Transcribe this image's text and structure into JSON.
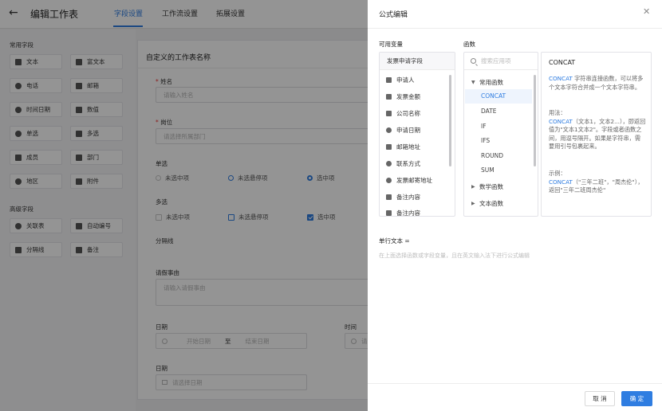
{
  "header": {
    "back_icon": "arrow-left-icon",
    "title": "编辑工作表",
    "tabs": [
      {
        "label": "字段设置",
        "active": true
      },
      {
        "label": "工作流设置",
        "active": false
      },
      {
        "label": "拓展设置",
        "active": false
      }
    ],
    "accent_color": "#2f7de1"
  },
  "sidebar": {
    "common_title": "常用字段",
    "common_items": [
      {
        "label": "文本",
        "icon": "text-icon"
      },
      {
        "label": "富文本",
        "icon": "rich-text-icon"
      },
      {
        "label": "电话",
        "icon": "phone-icon"
      },
      {
        "label": "邮箱",
        "icon": "mail-icon"
      },
      {
        "label": "时间日期",
        "icon": "clock-icon"
      },
      {
        "label": "数值",
        "icon": "number-icon"
      },
      {
        "label": "单选",
        "icon": "radio-icon"
      },
      {
        "label": "多选",
        "icon": "checkbox-icon"
      },
      {
        "label": "成员",
        "icon": "user-icon"
      },
      {
        "label": "部门",
        "icon": "department-icon"
      },
      {
        "label": "地区",
        "icon": "location-icon"
      },
      {
        "label": "附件",
        "icon": "attachment-icon"
      }
    ],
    "advanced_title": "高级字段",
    "advanced_items": [
      {
        "label": "关联表",
        "icon": "link-icon"
      },
      {
        "label": "自动编号",
        "icon": "auto-number-icon"
      },
      {
        "label": "分隔线",
        "icon": "divider-icon"
      },
      {
        "label": "备注",
        "icon": "note-icon"
      }
    ]
  },
  "form": {
    "title": "自定义的工作表名称",
    "name_label": "姓名",
    "name_placeholder": "请输入姓名",
    "position_label": "岗位",
    "position_placeholder": "请选择所属部门",
    "single_label": "单选",
    "single_options": [
      "未选中项",
      "未选悬停项",
      "选中项"
    ],
    "multi_label": "多选",
    "multi_options": [
      "未选中项",
      "未选悬停项",
      "选中项"
    ],
    "divider_label": "分隔线",
    "reason_label": "请假事由",
    "reason_placeholder": "请输入请假事由",
    "date_label": "日期",
    "date_start": "开始日期",
    "date_to": "至",
    "date_end": "结束日期",
    "time_label": "时间",
    "time_placeholder": "请",
    "date2_label": "日期",
    "date2_placeholder": "请选择日期"
  },
  "drawer": {
    "title": "公式编辑",
    "close_icon": "close-icon",
    "vars_heading": "可用变量",
    "vars_group": "发票申请字段",
    "vars": [
      {
        "label": "申请人",
        "icon": "user-icon"
      },
      {
        "label": "发票金额",
        "icon": "number-icon"
      },
      {
        "label": "公司名称",
        "icon": "text-icon"
      },
      {
        "label": "申请日期",
        "icon": "clock-icon"
      },
      {
        "label": "邮箱地址",
        "icon": "mail-icon"
      },
      {
        "label": "联系方式",
        "icon": "phone-icon"
      },
      {
        "label": "发票邮寄地址",
        "icon": "location-icon"
      },
      {
        "label": "备注内容",
        "icon": "note-icon"
      },
      {
        "label": "备注内容",
        "icon": "note-icon"
      }
    ],
    "funcs_heading": "函数",
    "search_placeholder": "搜索应用项",
    "func_groups": [
      {
        "label": "常用函数",
        "expanded": true,
        "items": [
          "CONCAT",
          "DATE",
          "IF",
          "IFS",
          "ROUND",
          "SUM"
        ],
        "selected": "CONCAT"
      },
      {
        "label": "数学函数",
        "expanded": false
      },
      {
        "label": "文本函数",
        "expanded": false
      }
    ],
    "desc": {
      "title": "CONCAT",
      "summary_fn": "CONCAT",
      "summary": " 字符串连接函数，可以将多个文本字符合并成一个文本字符串。",
      "usage_label": "用法：",
      "usage_fn": "CONCAT",
      "usage": "（文本1，文本2...），即返回值为\"文本1文本2\"。字段或者函数之间，用逗号隔开。如果是字符串，需要用引号包裹起来。",
      "example_label": "示例：",
      "example_fn": "CONCAT",
      "example": "（\"三年二班\"，\"周杰伦\"），返回\"三年二班周杰伦\""
    },
    "formula_label": "单行文本 =",
    "formula_hint": "在上面选择函数或字段变量，且在英文输入法下进行公式编辑",
    "cancel_label": "取 消",
    "ok_label": "确 定"
  }
}
